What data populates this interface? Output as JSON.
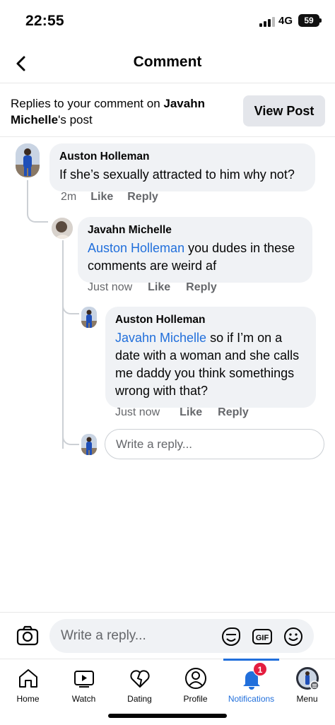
{
  "status_bar": {
    "time": "22:55",
    "network": "4G",
    "battery": "59"
  },
  "header": {
    "title": "Comment"
  },
  "context": {
    "prefix": "Replies to your comment on ",
    "post_owner_first": "Javahn",
    "post_owner_last": "Michelle",
    "suffix": "'s post",
    "view_post_label": "View Post"
  },
  "comments": [
    {
      "author": "Auston Holleman",
      "text": "If she’s sexually attracted to him why not?",
      "time": "2m",
      "like_label": "Like",
      "reply_label": "Reply"
    },
    {
      "author": "Javahn Michelle",
      "mention": "Auston Holleman",
      "text": " you dudes in these comments are weird af",
      "time": "Just now",
      "like_label": "Like",
      "reply_label": "Reply"
    },
    {
      "author": "Auston Holleman",
      "mention": "Javahn Michelle",
      "text": " so if I’m on a date with a woman and she calls me daddy you think somethings wrong with that?",
      "time": "Just now",
      "like_label": "Like",
      "reply_label": "Reply"
    }
  ],
  "thread_reply": {
    "placeholder": "Write a reply..."
  },
  "composer": {
    "placeholder": "Write a reply...",
    "icons": [
      "camera-icon",
      "sticker-icon",
      "gif-icon",
      "emoji-icon"
    ],
    "gif_label": "GIF"
  },
  "tabs": [
    {
      "label": "Home",
      "icon": "home-icon"
    },
    {
      "label": "Watch",
      "icon": "watch-icon"
    },
    {
      "label": "Dating",
      "icon": "dating-icon"
    },
    {
      "label": "Profile",
      "icon": "profile-icon"
    },
    {
      "label": "Notifications",
      "icon": "bell-icon",
      "active": true,
      "badge": "1"
    },
    {
      "label": "Menu",
      "icon": "menu-avatar-icon"
    }
  ],
  "colors": {
    "accent": "#216fdb",
    "bubble": "#f0f2f5",
    "muted": "#65676b",
    "badge": "#e41e3f"
  }
}
